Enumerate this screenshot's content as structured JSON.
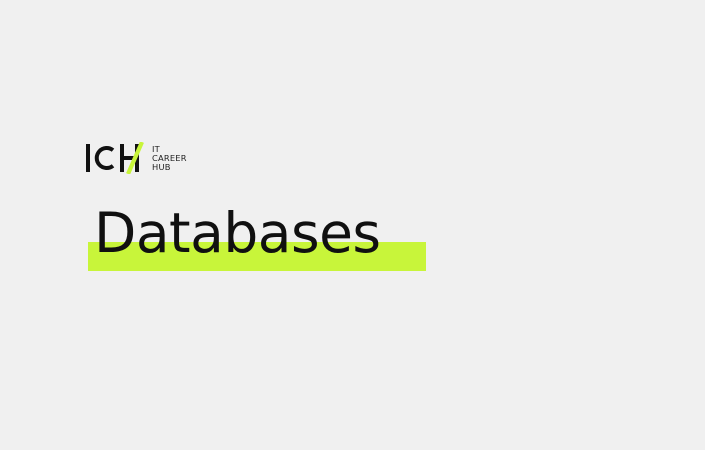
{
  "logo": {
    "mark_text": "ICH",
    "lines": [
      "IT",
      "CAREER",
      "HUB"
    ]
  },
  "slide": {
    "title": "Databases"
  },
  "colors": {
    "background": "#f0f0f0",
    "accent": "#c8f53a",
    "text": "#101010"
  },
  "icons": {
    "logo": "ich-logo-icon"
  }
}
